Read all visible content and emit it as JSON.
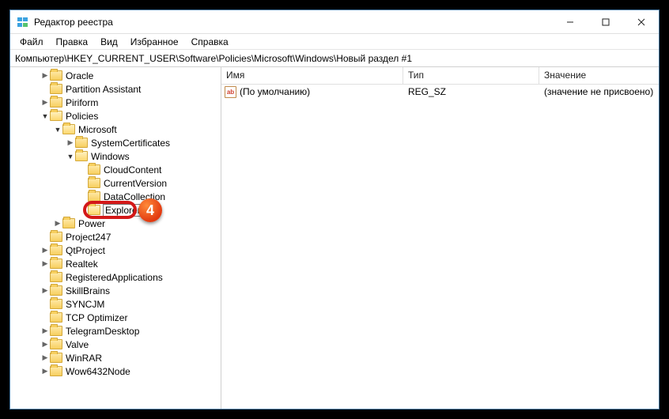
{
  "window": {
    "title": "Редактор реестра"
  },
  "menu": {
    "file": "Файл",
    "edit": "Правка",
    "view": "Вид",
    "favorites": "Избранное",
    "help": "Справка"
  },
  "address": "Компьютер\\HKEY_CURRENT_USER\\Software\\Policies\\Microsoft\\Windows\\Новый раздел #1",
  "columns": {
    "name": "Имя",
    "type": "Тип",
    "value": "Значение"
  },
  "row": {
    "name": "(По умолчанию)",
    "type": "REG_SZ",
    "value": "(значение не присвоено)"
  },
  "tree": {
    "oracle": "Oracle",
    "partition": "Partition Assistant",
    "piriform": "Piriform",
    "policies": "Policies",
    "microsoft": "Microsoft",
    "syscert": "SystemCertificates",
    "windows": "Windows",
    "cloud": "CloudContent",
    "curver": "CurrentVersion",
    "datacol": "DataCollection",
    "explorer_edit": "Explorer",
    "power": "Power",
    "project247": "Project247",
    "qtproject": "QtProject",
    "realtek": "Realtek",
    "regapps": "RegisteredApplications",
    "skillbrains": "SkillBrains",
    "syncjm": "SYNCJM",
    "tcpopt": "TCP Optimizer",
    "telegram": "TelegramDesktop",
    "valve": "Valve",
    "winrar": "WinRAR",
    "wow64": "Wow6432Node"
  },
  "step": "4"
}
